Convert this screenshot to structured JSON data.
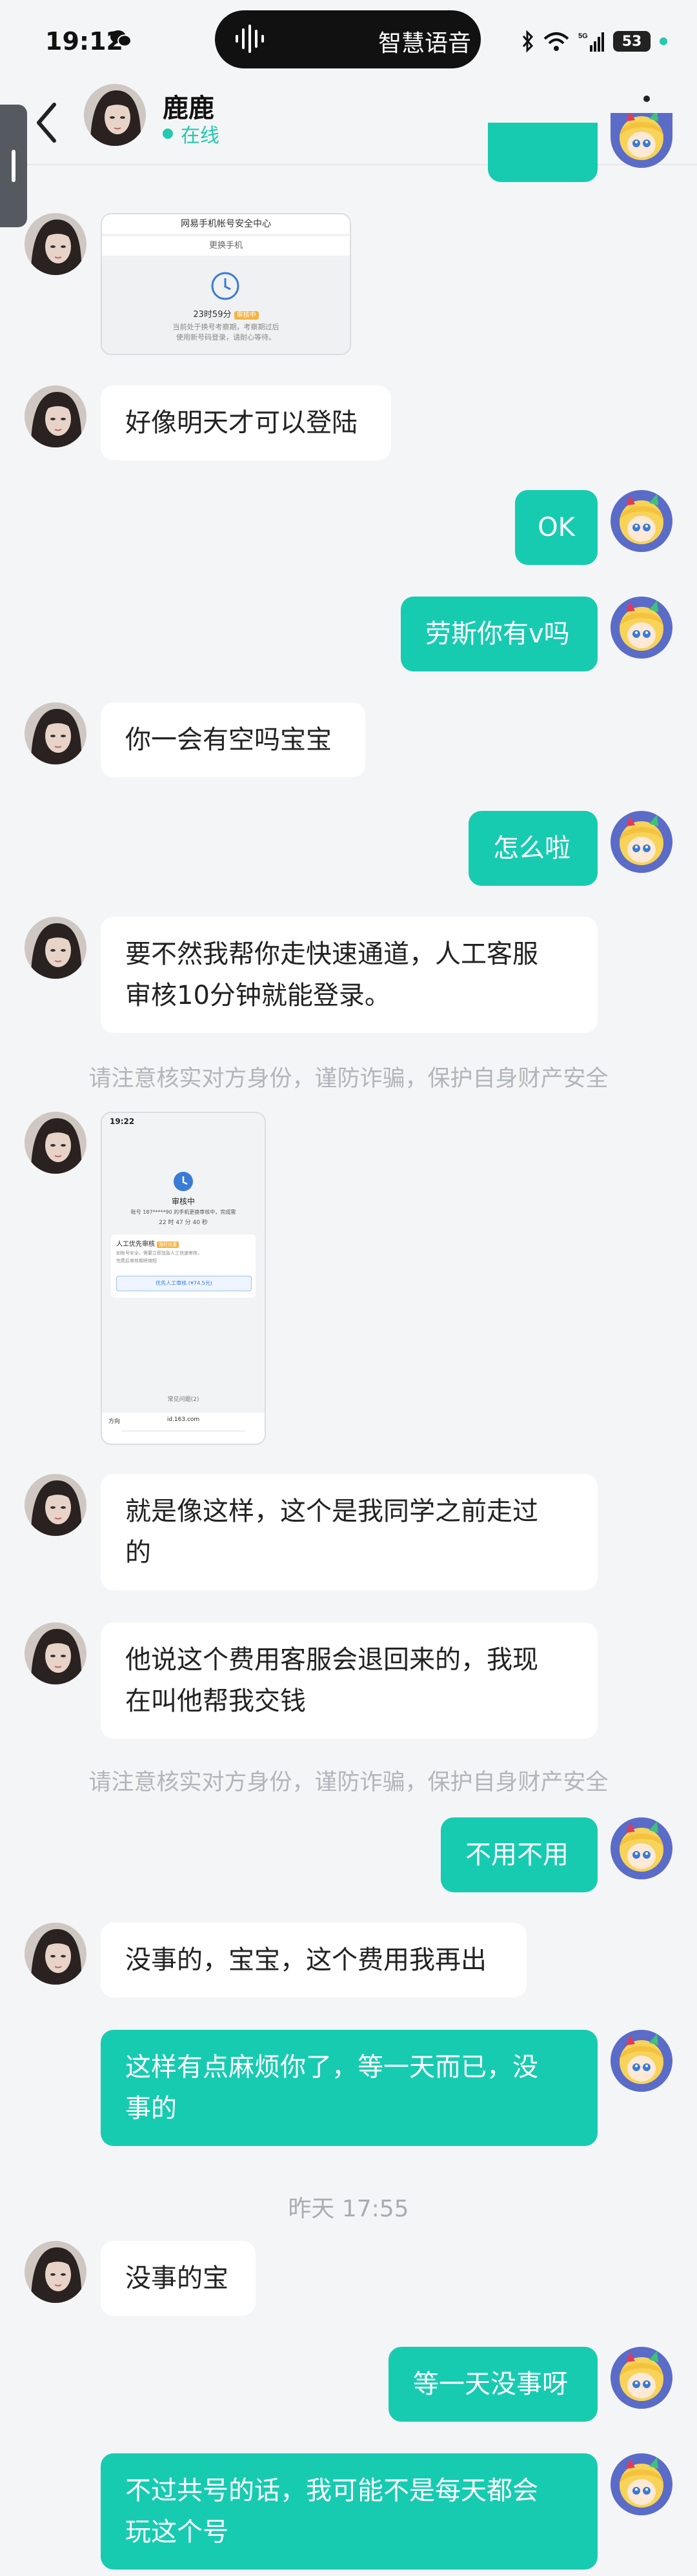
{
  "status_bar": {
    "time": "19:12",
    "pill_text": "智慧语音",
    "battery": "53"
  },
  "header": {
    "name": "鹿鹿",
    "status": "在线"
  },
  "security_notice": "请注意核实对方身份，谨防诈骗，保护自身财产安全",
  "img1": {
    "title": "网易手机帐号安全中心",
    "subtitle": "更换手机",
    "timer": "23时59分",
    "badge": "审核中",
    "text1": "当前处于换号考察期，考察期过后",
    "text2": "使用新号码登录，请耐心等待。"
  },
  "img2": {
    "time": "19:22",
    "state": "审核中",
    "note": "账号 187*****90 的手机更换审核中，完成需",
    "countdown": "22 时 47 分 40 秒",
    "card_title": "人工优先审核",
    "card_badge": "限时优惠",
    "card_text1": "如账号安全、需要立即加急人工快速审核，",
    "card_text2": "完费后审核期将缩短",
    "card_button": "优先人工审核 (¥74.5元)",
    "footer_link": "常见问题(2)",
    "url": "id.163.com",
    "tab_label": "方向"
  },
  "messages": {
    "m1": "好像明天才可以登陆",
    "m2": "OK",
    "m3": "劳斯你有v吗",
    "m4": "你一会有空吗宝宝",
    "m5": "怎么啦",
    "m6a": "要不然我帮你走快速通道，人工客服",
    "m6b": "审核10分钟就能登录。",
    "m7a": "就是像这样，这个是我同学之前走过",
    "m7b": "的",
    "m8a": "他说这个费用客服会退回来的，我现",
    "m8b": "在叫他帮我交钱",
    "m9": "不用不用",
    "m10": "没事的，宝宝，这个费用我再出",
    "m11a": "这样有点麻烦你了，等一天而已，没",
    "m11b": "事的",
    "timestamp": "昨天  17:55",
    "m12": "没事的宝",
    "m13": "等一天没事呀",
    "m14a": "不过共号的话，我可能不是每天都会",
    "m14b": "玩这个号"
  },
  "colors": {
    "accent": "#17cbb1",
    "background": "#f4f5f7",
    "bubble_left": "#ffffff"
  },
  "icons": [
    "back-arrow-icon",
    "more-icon",
    "voice-wave-icon",
    "wechat-icon",
    "bluetooth-icon",
    "wifi-icon",
    "signal-icon",
    "battery-icon",
    "clock-icon"
  ]
}
